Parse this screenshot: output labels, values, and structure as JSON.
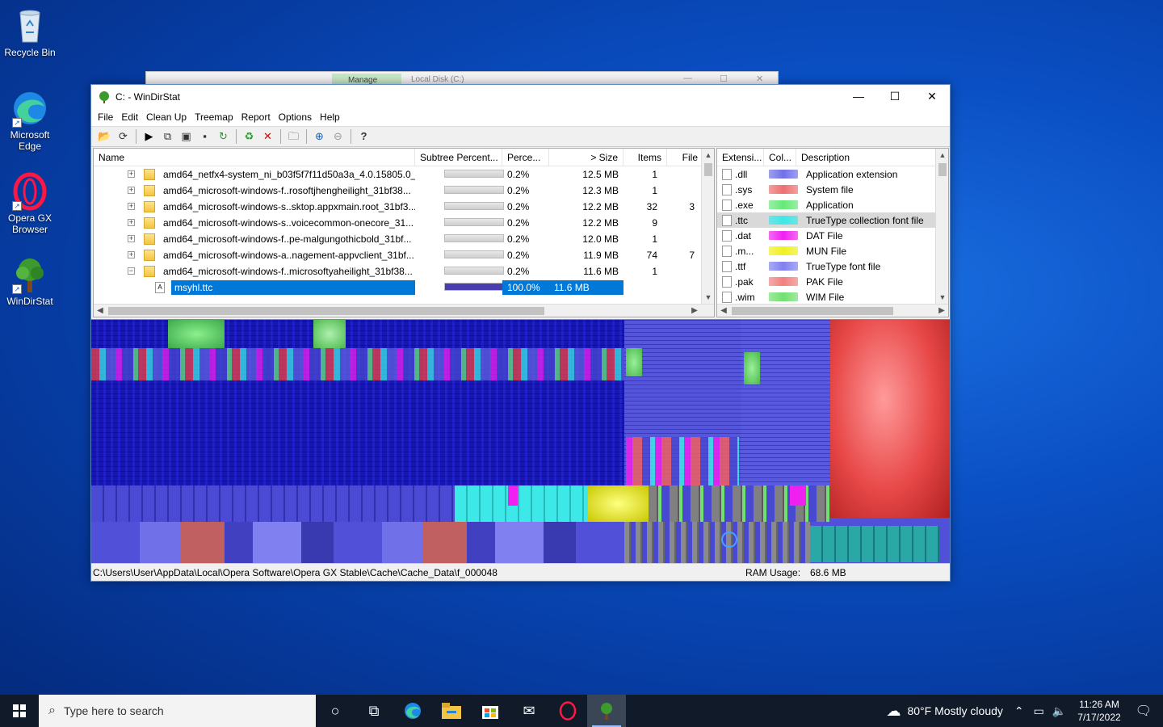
{
  "desktop": {
    "icons": [
      {
        "label": "Recycle Bin"
      },
      {
        "label": "Microsoft Edge"
      },
      {
        "label": "Opera GX Browser"
      },
      {
        "label": "WinDirStat"
      }
    ]
  },
  "background_window": {
    "tab_label": "Manage",
    "title": "Local Disk (C:)"
  },
  "window": {
    "title": "C: - WinDirStat",
    "menu": [
      "File",
      "Edit",
      "Clean Up",
      "Treemap",
      "Report",
      "Options",
      "Help"
    ]
  },
  "tree": {
    "columns": [
      "Name",
      "Subtree Percent...",
      "Perce...",
      "> Size",
      "Items",
      "File"
    ],
    "rows": [
      {
        "name": "amd64_netfx4-system_ni_b03f5f7f11d50a3a_4.0.15805.0_n...",
        "pct": "0.2%",
        "size": "12.5 MB",
        "items": "1",
        "files": "",
        "expander": "+"
      },
      {
        "name": "amd64_microsoft-windows-f..rosoftjhengheilight_31bf38...",
        "pct": "0.2%",
        "size": "12.3 MB",
        "items": "1",
        "files": "",
        "expander": "+"
      },
      {
        "name": "amd64_microsoft-windows-s..sktop.appxmain.root_31bf3...",
        "pct": "0.2%",
        "size": "12.2 MB",
        "items": "32",
        "files": "3",
        "expander": "+"
      },
      {
        "name": "amd64_microsoft-windows-s..voicecommon-onecore_31...",
        "pct": "0.2%",
        "size": "12.2 MB",
        "items": "9",
        "files": "",
        "expander": "+"
      },
      {
        "name": "amd64_microsoft-windows-f..pe-malgungothicbold_31bf...",
        "pct": "0.2%",
        "size": "12.0 MB",
        "items": "1",
        "files": "",
        "expander": "+"
      },
      {
        "name": "amd64_microsoft-windows-a..nagement-appvclient_31bf...",
        "pct": "0.2%",
        "size": "11.9 MB",
        "items": "74",
        "files": "7",
        "expander": "+"
      },
      {
        "name": "amd64_microsoft-windows-f..microsoftyaheilight_31bf38...",
        "pct": "0.2%",
        "size": "11.6 MB",
        "items": "1",
        "files": "",
        "expander": "−"
      },
      {
        "name": "msyhl.ttc",
        "pct": "100.0%",
        "size": "11.6 MB",
        "items": "",
        "files": "",
        "expander": "",
        "selected": true
      }
    ]
  },
  "extensions": {
    "columns": [
      "Extensi...",
      "Col...",
      "Description"
    ],
    "rows": [
      {
        "ext": ".dll",
        "color": "#7070e8",
        "desc": "Application extension"
      },
      {
        "ext": ".sys",
        "color": "#ee7070",
        "desc": "System file"
      },
      {
        "ext": ".exe",
        "color": "#66e878",
        "desc": "Application"
      },
      {
        "ext": ".ttc",
        "color": "#3ce8e8",
        "desc": "TrueType collection font file",
        "selected": true
      },
      {
        "ext": ".dat",
        "color": "#f020f0",
        "desc": "DAT File"
      },
      {
        "ext": ".m...",
        "color": "#f0f020",
        "desc": "MUN File"
      },
      {
        "ext": ".ttf",
        "color": "#8080f0",
        "desc": "TrueType font file"
      },
      {
        "ext": ".pak",
        "color": "#f08080",
        "desc": "PAK File"
      },
      {
        "ext": ".wim",
        "color": "#70e070",
        "desc": "WIM File"
      }
    ]
  },
  "status": {
    "path": "C:\\Users\\User\\AppData\\Local\\Opera Software\\Opera GX Stable\\Cache\\Cache_Data\\f_000048",
    "ram_label": "RAM Usage:",
    "ram_value": "68.6 MB"
  },
  "taskbar": {
    "search_placeholder": "Type here to search",
    "weather": "80°F  Mostly cloudy",
    "time": "11:26 AM",
    "date": "7/17/2022"
  }
}
